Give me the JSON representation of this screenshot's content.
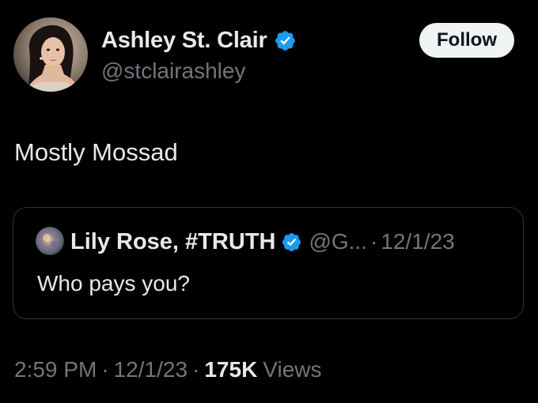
{
  "author": {
    "display_name": "Ashley St. Clair",
    "handle": "@stclairashley",
    "verified": true,
    "avatar_icon": "profile-photo"
  },
  "follow_button": {
    "label": "Follow"
  },
  "tweet": {
    "text": "Mostly Mossad"
  },
  "quoted_tweet": {
    "display_name": "Lily Rose, #TRUTH",
    "handle": "@G...",
    "separator": "·",
    "date": "12/1/23",
    "verified": true,
    "avatar_icon": "profile-photo",
    "text": "Who pays you?"
  },
  "meta": {
    "time": "2:59 PM",
    "separator": "·",
    "date": "12/1/23",
    "views_count": "175K",
    "views_label": "Views"
  },
  "colors": {
    "background": "#000000",
    "primary_text": "#e7e9ea",
    "secondary_text": "#71767b",
    "verified_blue": "#1d9bf0",
    "border": "#2f3336",
    "follow_bg": "#eff3f4"
  }
}
